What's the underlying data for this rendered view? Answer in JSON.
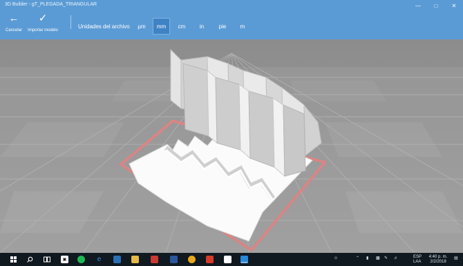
{
  "window": {
    "title": "3D Builder - gT_PLEGADA_TRIANGULAR"
  },
  "toolbar": {
    "cancel_label": "Cancelar",
    "import_label": "Importar modelo",
    "units_label": "Unidades del archivo",
    "units": [
      "µm",
      "mm",
      "cm",
      "in",
      "pie",
      "m"
    ],
    "selected_unit": "mm"
  },
  "taskbar": {
    "language": "ESP",
    "language_sub": "LAA",
    "time": "4:40 p. m.",
    "date": "2/2/2018"
  },
  "colors": {
    "accent": "#5b9bd5",
    "viewport_background": "#9a9a9a",
    "plate_outline": "#d97f7f",
    "taskbar": "#101820"
  },
  "icons": [
    "back-arrow-icon",
    "check-icon",
    "minimize-icon",
    "maximize-icon",
    "close-icon",
    "windows-start-icon",
    "search-icon",
    "task-view-icon"
  ]
}
